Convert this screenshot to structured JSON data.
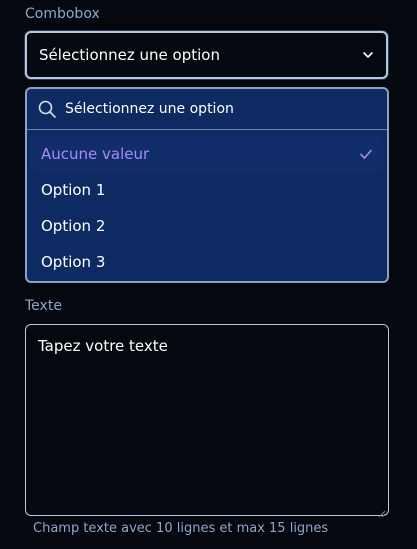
{
  "combobox": {
    "label": "Combobox",
    "value": "Sélectionnez une option",
    "search_placeholder": "Sélectionnez une option",
    "options": [
      {
        "label": "Aucune valeur",
        "selected": true
      },
      {
        "label": "Option 1",
        "selected": false
      },
      {
        "label": "Option 2",
        "selected": false
      },
      {
        "label": "Option 3",
        "selected": false
      }
    ],
    "chevron_icon": "chevron-down-icon",
    "search_icon": "search-icon",
    "check_icon": "check-icon"
  },
  "text_field": {
    "label": "Texte",
    "placeholder": "Tapez votre texte",
    "helper": "Champ texte avec 10 lignes et max 15 lignes"
  },
  "colors": {
    "background": "#05090f",
    "dropdown_bg": "#0d2a63",
    "selected_text": "#a78bfa",
    "label_text": "#8fa6c8"
  }
}
